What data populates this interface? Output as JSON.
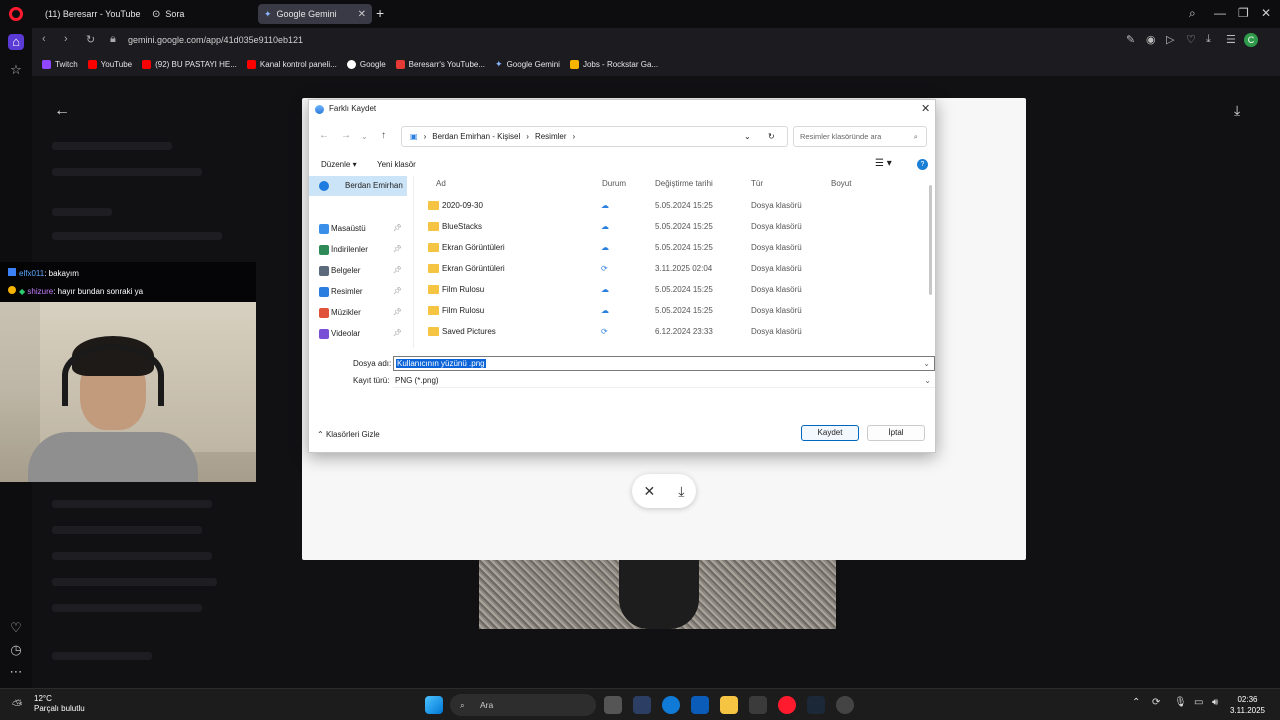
{
  "tabs": [
    {
      "title": "(11) Beresarr - YouTube"
    },
    {
      "title": "Sora"
    },
    {
      "title": "Google Gemini"
    }
  ],
  "address": {
    "url": "gemini.google.com/app/41d035e9110eb121"
  },
  "bookmarks": [
    {
      "label": "Twitch",
      "color": "#9146ff"
    },
    {
      "label": "YouTube",
      "color": "#ff0000"
    },
    {
      "label": "(92) BU PASTAYI HE...",
      "color": "#ff0000"
    },
    {
      "label": "Kanal kontrol paneli...",
      "color": "#ff0000"
    },
    {
      "label": "Google",
      "color": "#4285f4"
    },
    {
      "label": "Beresarr's YouTube...",
      "color": "#e53935"
    },
    {
      "label": "Google Gemini",
      "color": "#4b8ef5"
    },
    {
      "label": "Jobs - Rockstar Ga...",
      "color": "#f7b500"
    }
  ],
  "dialog": {
    "title": "Farklı Kaydet",
    "path": [
      "Berdan Emirhan - Kişisel",
      "Resimler"
    ],
    "search_placeholder": "Resimler klasöründe ara",
    "toolbar": {
      "organize": "Düzenle",
      "new_folder": "Yeni klasör"
    },
    "nav": [
      {
        "label": "Berdan Emirhan",
        "color": "#1e7be0"
      },
      {
        "label": "Masaüstü",
        "color": "#3a8fe8"
      },
      {
        "label": "İndirilenler",
        "color": "#2e8b57"
      },
      {
        "label": "Belgeler",
        "color": "#5b6b7c"
      },
      {
        "label": "Resimler",
        "color": "#2a7ee0"
      },
      {
        "label": "Müzikler",
        "color": "#e0533a"
      },
      {
        "label": "Videolar",
        "color": "#7a4fd8"
      }
    ],
    "columns": {
      "name": "Ad",
      "status": "Durum",
      "modified": "Değiştirme tarihi",
      "type": "Tür",
      "size": "Boyut"
    },
    "files": [
      {
        "name": "2020-09-30",
        "status": "☁",
        "modified": "5.05.2024 15:25",
        "type": "Dosya klasörü"
      },
      {
        "name": "BlueStacks",
        "status": "☁",
        "modified": "5.05.2024 15:25",
        "type": "Dosya klasörü"
      },
      {
        "name": "Ekran Görüntüleri",
        "status": "☁",
        "modified": "5.05.2024 15:25",
        "type": "Dosya klasörü"
      },
      {
        "name": "Ekran Görüntüleri",
        "status": "⟳",
        "modified": "3.11.2025 02:04",
        "type": "Dosya klasörü"
      },
      {
        "name": "Film Rulosu",
        "status": "☁",
        "modified": "5.05.2024 15:25",
        "type": "Dosya klasörü"
      },
      {
        "name": "Film Rulosu",
        "status": "☁",
        "modified": "5.05.2024 15:25",
        "type": "Dosya klasörü"
      },
      {
        "name": "Saved Pictures",
        "status": "⟳",
        "modified": "6.12.2024 23:33",
        "type": "Dosya klasörü"
      }
    ],
    "filename_label": "Dosya adı:",
    "filename_value": "Kullanıcının yüzünü .png",
    "filetype_label": "Kayıt türü:",
    "filetype_value": "PNG (*.png)",
    "hide_folders": "Klasörleri Gizle",
    "save": "Kaydet",
    "cancel": "İptal"
  },
  "chat": [
    {
      "user": "elfx011",
      "text": "bakayım",
      "color": "#5aa9ff"
    },
    {
      "user": "shizure",
      "text": "hayır bundan sonraki ya",
      "color": "#c77dff"
    }
  ],
  "taskbar": {
    "temp": "12°C",
    "weather": "Parçalı bulutlu",
    "search": "Ara",
    "time": "02:36",
    "date": "3.11.2025"
  }
}
